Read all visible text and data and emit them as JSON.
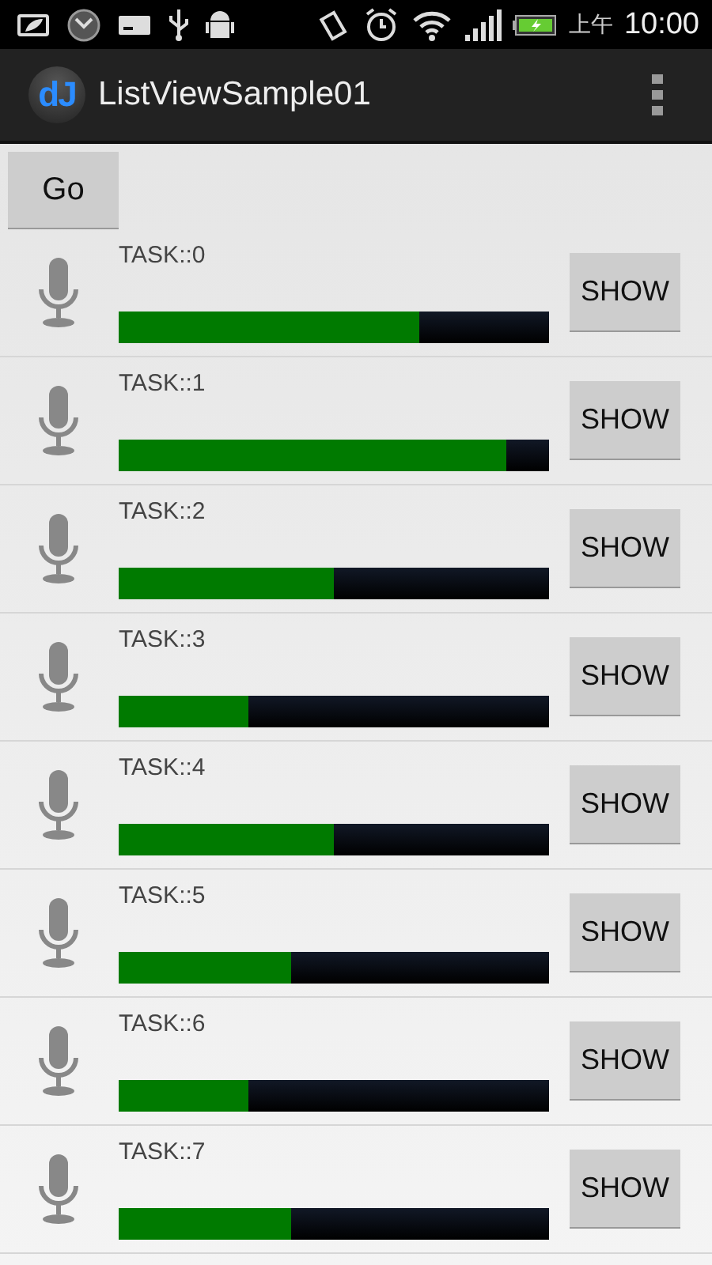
{
  "status_bar": {
    "ampm": "上午",
    "time": "10:00"
  },
  "action_bar": {
    "logo": "dJ",
    "title": "ListViewSample01"
  },
  "go_button": "Go",
  "tasks": [
    {
      "label": "TASK::0",
      "level": 0.7,
      "button": "SHOW"
    },
    {
      "label": "TASK::1",
      "level": 0.9,
      "button": "SHOW"
    },
    {
      "label": "TASK::2",
      "level": 0.5,
      "button": "SHOW"
    },
    {
      "label": "TASK::3",
      "level": 0.3,
      "button": "SHOW"
    },
    {
      "label": "TASK::4",
      "level": 0.5,
      "button": "SHOW"
    },
    {
      "label": "TASK::5",
      "level": 0.4,
      "button": "SHOW"
    },
    {
      "label": "TASK::6",
      "level": 0.3,
      "button": "SHOW"
    },
    {
      "label": "TASK::7",
      "level": 0.4,
      "button": "SHOW"
    }
  ]
}
